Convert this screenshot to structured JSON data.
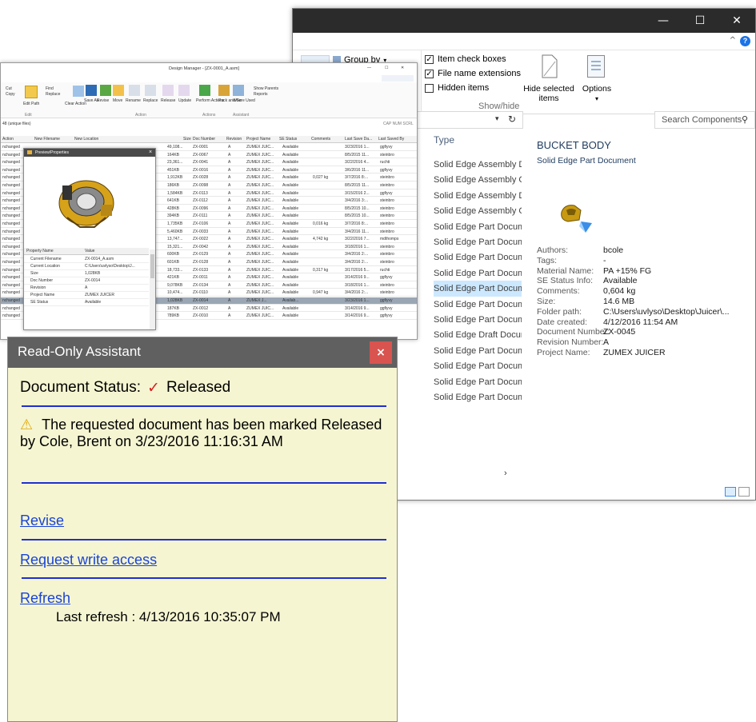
{
  "explorer": {
    "controls": {
      "minimize": "—",
      "maximize": "☐",
      "close": "✕"
    },
    "ribbon": {
      "group_by": "Group by",
      "item_check_boxes": "Item check boxes",
      "file_name_extensions": "File name extensions",
      "hidden_items": "Hidden items",
      "hide_selected_items": "Hide selected items",
      "options": "Options",
      "show_hide_group": "Show/hide"
    },
    "search_placeholder": "Search Components",
    "type_header": "Type",
    "type_items": [
      "Solid Edge Assembly Dc",
      "Solid Edge Assembly Cc",
      "Solid Edge Assembly Dc",
      "Solid Edge Assembly Cc",
      "Solid Edge Part Docume",
      "Solid Edge Part Docume",
      "Solid Edge Part Docume",
      "Solid Edge Part Docume",
      "Solid Edge Part Docume",
      "Solid Edge Part Docume",
      "Solid Edge Part Docume",
      "Solid Edge Draft Docum",
      "Solid Edge Part Docume",
      "Solid Edge Part Docume",
      "Solid Edge Part Docume",
      "Solid Edge Part Docume"
    ],
    "details": {
      "title": "BUCKET BODY",
      "subtitle": "Solid Edge Part Document",
      "properties": [
        {
          "label": "Authors:",
          "value": "bcole"
        },
        {
          "label": "Tags:",
          "value": "-"
        },
        {
          "label": "Material Name:",
          "value": "PA +15%  FG"
        },
        {
          "label": "SE Status Info:",
          "value": "Available"
        },
        {
          "label": "Comments:",
          "value": "0,604 kg"
        },
        {
          "label": "Size:",
          "value": "14.6 MB"
        },
        {
          "label": "Folder path:",
          "value": "C:\\Users\\uvlyso\\Desktop\\Juicer\\..."
        },
        {
          "label": "Date created:",
          "value": "4/12/2016 11:54 AM"
        },
        {
          "label": "Document Number:",
          "value": "ZX-0045"
        },
        {
          "label": "Revision Number:",
          "value": "A"
        },
        {
          "label": "Project Name:",
          "value": "ZUMEX JUICER"
        }
      ]
    }
  },
  "design_manager": {
    "title": "Design Manager - [ZX-0001_A.asm]",
    "toolbar": [
      "Cut",
      "Copy",
      "Find",
      "Replace",
      "Edit Path",
      "Clear Action",
      "Save As",
      "Revise",
      "Move",
      "Rename",
      "Replace",
      "Release",
      "Update",
      "Perform Actions",
      "Pack and Go",
      "Where Used",
      "Show Parents",
      "Reports"
    ],
    "groups": [
      "Edit",
      "Action",
      "Actions",
      "Assistant"
    ],
    "status_line": "48 (unique files)",
    "status_right": "CAP NUM SCRL",
    "columns": [
      "Action",
      "New Filename",
      "New Location",
      "Size",
      "Doc Number",
      "Revision",
      "Project Name",
      "SE Status",
      "Comments",
      "Last Save Da...",
      "Last Saved By"
    ],
    "rows": [
      [
        "nchanged",
        "49,108...",
        "ZX-0001",
        "A",
        "ZUMEX JUIC...",
        "Available",
        "",
        "3/23/2016 1...",
        "ggfiyvy"
      ],
      [
        "nchanged",
        "164KB",
        "ZX-0067",
        "A",
        "ZUMEX JUIC...",
        "Available",
        "",
        "8/5/2015 11...",
        "steinbro"
      ],
      [
        "nchanged",
        "23,361...",
        "ZX-0041",
        "A",
        "ZUMEX JUIC...",
        "Available",
        "",
        "3/22/2016 4...",
        "ruchti"
      ],
      [
        "nchanged",
        "451KB",
        "ZX-0016",
        "A",
        "ZUMEX JUIC...",
        "Available",
        "",
        "3/6/2016 11...",
        "ggfiyvy"
      ],
      [
        "nchanged",
        "1,912KB",
        "ZX-0028",
        "A",
        "ZUMEX JUIC...",
        "Available",
        "0,027 kg",
        "3/7/2016 8:...",
        "steinbro"
      ],
      [
        "nchanged",
        "186KB",
        "ZX-0098",
        "A",
        "ZUMEX JUIC...",
        "Available",
        "",
        "8/5/2015 11...",
        "steinbro"
      ],
      [
        "nchanged",
        "1,584KB",
        "ZX-0113",
        "A",
        "ZUMEX JUIC...",
        "Available",
        "",
        "3/15/2016 2...",
        "ggfiyvy"
      ],
      [
        "nchanged",
        "641KB",
        "ZX-0112",
        "A",
        "ZUMEX JUIC...",
        "Available",
        "",
        "3/4/2016 3:...",
        "steinbro"
      ],
      [
        "nchanged",
        "428KB",
        "ZX-0096",
        "A",
        "ZUMEX JUIC...",
        "Available",
        "",
        "8/5/2015 10...",
        "steinbro"
      ],
      [
        "nchanged",
        "394KB",
        "ZX-0111",
        "A",
        "ZUMEX JUIC...",
        "Available",
        "",
        "8/5/2015 10...",
        "steinbro"
      ],
      [
        "nchanged",
        "1,735KB",
        "ZX-0106",
        "A",
        "ZUMEX JUIC...",
        "Available",
        "0,016 kg",
        "3/7/2016 8:...",
        "steinbro"
      ],
      [
        "nchanged",
        "5,460KB",
        "ZX-0033",
        "A",
        "ZUMEX JUIC...",
        "Available",
        "",
        "3/4/2016 11...",
        "steinbro"
      ],
      [
        "nchanged",
        "13,747...",
        "ZX-0022",
        "A",
        "ZUMEX JUIC...",
        "Available",
        "4,742 kg",
        "3/22/2016 7...",
        "mdthomps"
      ],
      [
        "nchanged",
        "15,321...",
        "ZX-0042",
        "A",
        "ZUMEX JUIC...",
        "Available",
        "",
        "3/18/2016 1...",
        "steinbro"
      ],
      [
        "nchanged",
        "600KB",
        "ZX-0129",
        "A",
        "ZUMEX JUIC...",
        "Available",
        "",
        "3/4/2016 2:...",
        "steinbro"
      ],
      [
        "nchanged",
        "601KB",
        "ZX-0128",
        "A",
        "ZUMEX JUIC...",
        "Available",
        "",
        "3/4/2016 2:...",
        "steinbro"
      ],
      [
        "nchanged",
        "18,733...",
        "ZX-0133",
        "A",
        "ZUMEX JUIC...",
        "Available",
        "0,317 kg",
        "3/17/2016 5...",
        "ruchti"
      ],
      [
        "nchanged",
        "421KB",
        "ZX-0011",
        "A",
        "ZUMEX JUIC...",
        "Available",
        "",
        "3/14/2016 9...",
        "ggfiyvy"
      ],
      [
        "nchanged",
        "9,078KB",
        "ZX-0134",
        "A",
        "ZUMEX JUIC...",
        "Available",
        "",
        "3/18/2016 1...",
        "steinbro"
      ],
      [
        "nchanged",
        "10,474...",
        "ZX-0110",
        "A",
        "ZUMEX JUIC...",
        "Available",
        "0,947 kg",
        "3/4/2016 2:...",
        "steinbro"
      ],
      [
        "nchanged",
        "1,028KB",
        "ZX-0014",
        "A",
        "ZUMEX J...",
        "Availab...",
        "",
        "3/23/2016 1...",
        "ggfiyvy"
      ],
      [
        "nchanged",
        "187KB",
        "ZX-0012",
        "A",
        "ZUMEX JUIC...",
        "Available",
        "",
        "3/14/2016 9...",
        "ggfiyvy"
      ],
      [
        "nchanged",
        "789KB",
        "ZX-0010",
        "A",
        "ZUMEX JUIC...",
        "Available",
        "",
        "3/14/2016 9...",
        "ggfiyvy"
      ]
    ],
    "preview": {
      "title": "Preview/Properties",
      "columns": [
        "Property Name",
        "Value"
      ],
      "rows": [
        [
          "Current Filename",
          "ZX-0014_A.asm"
        ],
        [
          "Current Location",
          "C:\\Users\\uvlyso\\Desktop\\J..."
        ],
        [
          "Size",
          "1,028KB"
        ],
        [
          "Doc Number",
          "ZX-0014"
        ],
        [
          "Revision",
          "A"
        ],
        [
          "Project Name",
          "ZUMEX JUICER"
        ],
        [
          "SE Status",
          "Available"
        ]
      ]
    }
  },
  "assistant": {
    "title": "Read-Only Assistant",
    "close": "×",
    "status_label": "Document Status:",
    "status_mark": "✓",
    "status_value": "Released",
    "warning_icon": "⚠",
    "message": "The requested document has been marked Released by Cole, Brent on 3/23/2016 11:16:31 AM",
    "revise": "Revise",
    "request_write": "Request write access",
    "refresh": "Refresh",
    "last_refresh": "Last refresh : 4/13/2016 10:35:07 PM",
    "colors": {
      "header": "#606060",
      "background": "#f5f5d2",
      "link": "#1a44d6",
      "divider": "#1f2fd0",
      "check": "#d62020",
      "close": "#d9534f"
    }
  }
}
